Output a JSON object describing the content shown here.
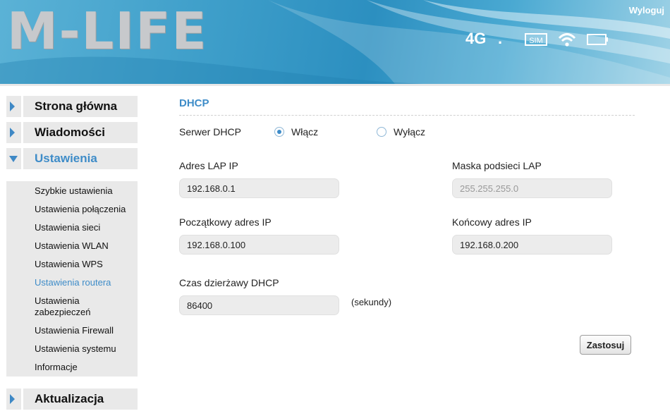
{
  "header": {
    "logo": "M-LIFE",
    "logout_label": "Wyloguj",
    "network_type": "4G",
    "network_dot": ".",
    "icons": [
      "sim-icon",
      "wifi-icon",
      "battery-icon"
    ],
    "colors": {
      "accent": "#3e8cc8",
      "header_blue": "#2c8fc0"
    }
  },
  "sidebar": {
    "main_items": [
      {
        "label": "Strona główna"
      },
      {
        "label": "Wiadomości"
      },
      {
        "label": "Ustawienia"
      },
      {
        "label": "Aktualizacja"
      }
    ],
    "sub_items": [
      {
        "label": "Szybkie ustawienia"
      },
      {
        "label": "Ustawienia połączenia"
      },
      {
        "label": "Ustawienia sieci"
      },
      {
        "label": "Ustawienia WLAN"
      },
      {
        "label": "Ustawienia WPS"
      },
      {
        "label": "Ustawienia routera"
      },
      {
        "label": "Ustawienia zabezpieczeń"
      },
      {
        "label": "Ustawienia Firewall"
      },
      {
        "label": "Ustawienia systemu"
      },
      {
        "label": "Informacje"
      }
    ]
  },
  "main": {
    "section_title": "DHCP",
    "dhcp_server": {
      "label": "Serwer DHCP",
      "option_on": "Włącz",
      "option_off": "Wyłącz",
      "selected": "Włącz"
    },
    "lan_ip": {
      "label": "Adres LAP IP",
      "value": "192.168.0.1"
    },
    "subnet_mask": {
      "label": "Maska podsieci LAP",
      "value": "255.255.255.0"
    },
    "start_ip": {
      "label": "Początkowy adres IP",
      "value": "192.168.0.100"
    },
    "end_ip": {
      "label": "Końcowy adres IP",
      "value": "192.168.0.200"
    },
    "lease_time": {
      "label": "Czas dzierżawy DHCP",
      "value": "86400",
      "unit": "(sekundy)"
    },
    "apply_label": "Zastosuj"
  }
}
